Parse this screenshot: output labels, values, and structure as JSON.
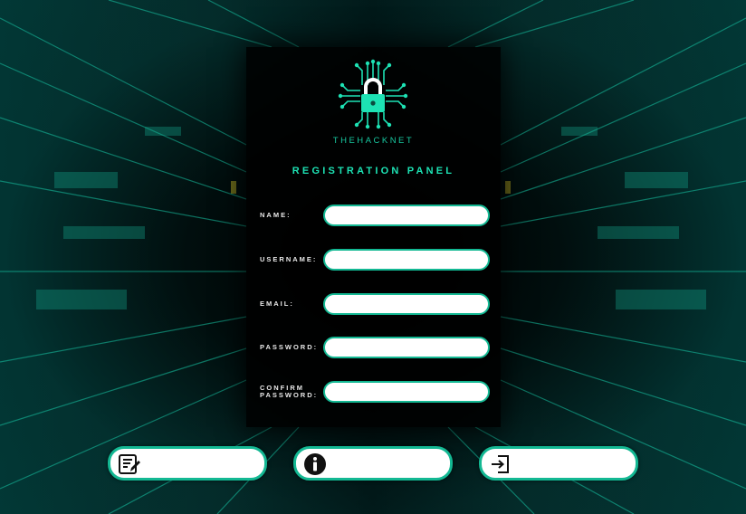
{
  "app": {
    "brand_name": "THEHACKNET",
    "panel_title": "REGISTRATION PANEL"
  },
  "colors": {
    "accent": "#13b893",
    "title_text": "#1de2b4",
    "panel_bg": "#000000",
    "label_text": "#e8e8e8"
  },
  "form": {
    "fields": [
      {
        "label": "NAME:",
        "value": "",
        "placeholder": ""
      },
      {
        "label": "USERNAME:",
        "value": "",
        "placeholder": ""
      },
      {
        "label": "EMAIL:",
        "value": "",
        "placeholder": ""
      },
      {
        "label": "PASSWORD:",
        "value": "",
        "placeholder": ""
      },
      {
        "label_line1": "CONFIRM",
        "label_line2": "PASSWORD:",
        "value": "",
        "placeholder": ""
      }
    ]
  },
  "actions": [
    {
      "icon": "edit-notes-icon"
    },
    {
      "icon": "info-icon"
    },
    {
      "icon": "sign-in-icon"
    }
  ]
}
